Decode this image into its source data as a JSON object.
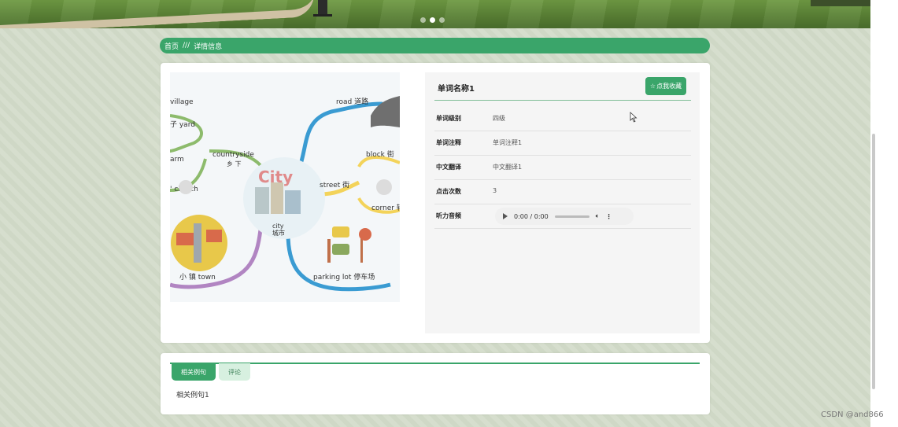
{
  "breadcrumb": {
    "home": "首页",
    "sep": "///",
    "current": "详情信息"
  },
  "word": {
    "title": "单词名称1",
    "fav_label": "点我收藏"
  },
  "details": [
    {
      "label": "单词级别",
      "value": "四级"
    },
    {
      "label": "单词注释",
      "value": "单词注释1"
    },
    {
      "label": "中文翻译",
      "value": "中文翻译1"
    },
    {
      "label": "点击次数",
      "value": "3"
    },
    {
      "label": "听力音频",
      "value": ""
    }
  ],
  "audio": {
    "time": "0:00 / 0:00"
  },
  "tabs": [
    {
      "label": "相关例句",
      "active": true
    },
    {
      "label": "评论",
      "active": false
    }
  ],
  "tab_content": "相关例句1",
  "carousel": {
    "count": 3,
    "active_index": 1
  },
  "mindmap": {
    "center": "City",
    "center_en": "city",
    "center_cn": "城市",
    "labels": {
      "village": "village",
      "yard": "子 yard",
      "farm": "arm",
      "church": "' church",
      "countryside": "countryside",
      "countryside_cn": "乡 下",
      "road": "road 道路",
      "block": "block 街",
      "street": "street 街",
      "corner": "corner 转",
      "town": "小 镇  town",
      "parking": "parking lot 停车场"
    }
  },
  "colors": {
    "accent": "#3aa56a",
    "accent_light": "#d7f0e0"
  },
  "watermark": "CSDN @and866"
}
